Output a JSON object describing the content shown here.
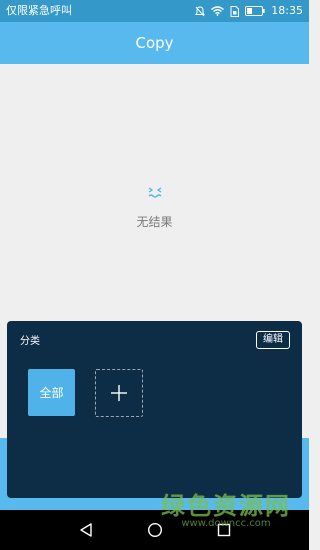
{
  "status_bar": {
    "carrier": "仅限紧急呼叫",
    "time": "18:35",
    "icons": [
      "mute-icon",
      "wifi-icon",
      "sim-icon",
      "battery-icon"
    ]
  },
  "header": {
    "title": "Copy"
  },
  "empty_state": {
    "icon": "face-icon",
    "text": "无结果"
  },
  "category_panel": {
    "title": "分类",
    "edit_label": "编辑",
    "categories": [
      {
        "label": "全部",
        "selected": true
      }
    ],
    "add_icon": "plus-icon"
  },
  "nav_bar": {
    "icons": [
      "back-icon",
      "home-icon",
      "recent-apps-icon"
    ]
  },
  "watermark": {
    "main": "绿色资源网",
    "sub": "www.downcc.com"
  },
  "colors": {
    "status_bar": "#3498c8",
    "header": "#57b9ee",
    "panel": "#0d2d47",
    "accent": "#4fb3ea"
  }
}
